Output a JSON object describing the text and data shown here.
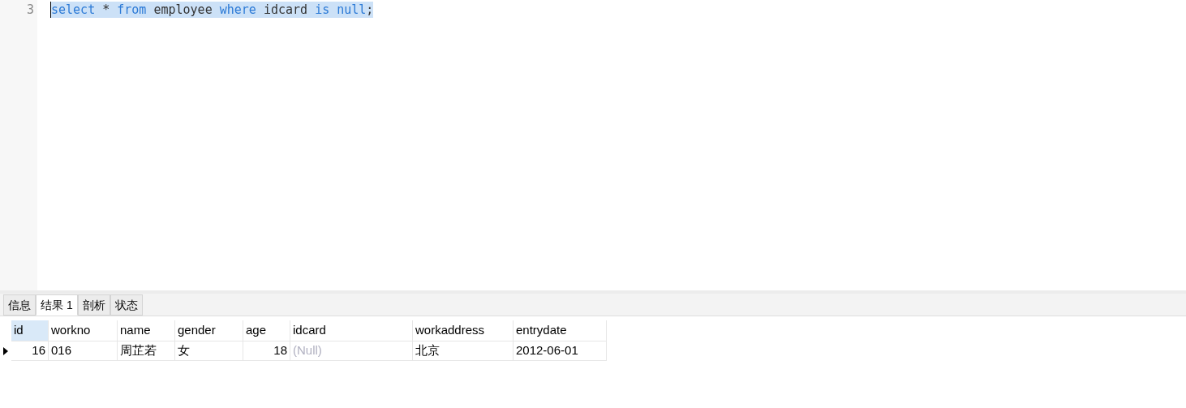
{
  "editor": {
    "lines": [
      {
        "number": "3",
        "selected": true,
        "tokens": [
          {
            "text": "select",
            "kind": "keyword"
          },
          {
            "text": " * ",
            "kind": "plain"
          },
          {
            "text": "from",
            "kind": "keyword"
          },
          {
            "text": " employee ",
            "kind": "plain"
          },
          {
            "text": "where",
            "kind": "keyword"
          },
          {
            "text": " idcard ",
            "kind": "plain"
          },
          {
            "text": "is null",
            "kind": "keyword"
          },
          {
            "text": ";",
            "kind": "plain"
          }
        ]
      }
    ]
  },
  "tabs": [
    {
      "label": "信息",
      "selected": false
    },
    {
      "label": "结果 1",
      "selected": true
    },
    {
      "label": "剖析",
      "selected": false
    },
    {
      "label": "状态",
      "selected": false
    }
  ],
  "table": {
    "columns": [
      {
        "label": "id",
        "kind": "number",
        "selected": true
      },
      {
        "label": "workno",
        "kind": "text",
        "selected": false
      },
      {
        "label": "name",
        "kind": "text",
        "selected": false
      },
      {
        "label": "gender",
        "kind": "text",
        "selected": false
      },
      {
        "label": "age",
        "kind": "number",
        "selected": false
      },
      {
        "label": "idcard",
        "kind": "text",
        "selected": false
      },
      {
        "label": "workaddress",
        "kind": "text",
        "selected": false
      },
      {
        "label": "entrydate",
        "kind": "text",
        "selected": false
      }
    ],
    "rows": [
      {
        "current": true,
        "cells": [
          {
            "text": "16",
            "null": false
          },
          {
            "text": "016",
            "null": false
          },
          {
            "text": "周芷若",
            "null": false
          },
          {
            "text": "女",
            "null": false
          },
          {
            "text": "18",
            "null": false
          },
          {
            "text": "(Null)",
            "null": true
          },
          {
            "text": "北京",
            "null": false
          },
          {
            "text": "2012-06-01",
            "null": false
          }
        ]
      }
    ]
  }
}
